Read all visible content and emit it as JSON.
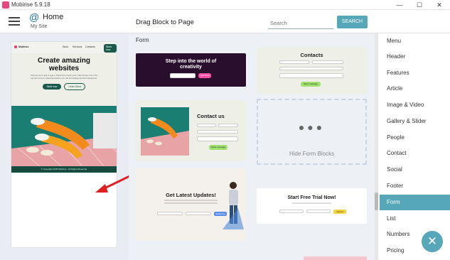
{
  "window": {
    "title": "Mobirise 5.9.18",
    "minimize": "—",
    "maximize": "☐",
    "close": "✕"
  },
  "header": {
    "home_title": "Home",
    "site_name": "My Site",
    "drag_title": "Drag Block to Page",
    "search_placeholder": "Search",
    "search_button": "SEARCH"
  },
  "preview": {
    "brand": "Mobirise",
    "nav_items": [
      "Work",
      "Services",
      "Contacts"
    ],
    "nav_button": "Work now",
    "hero_title": "Create amazing websites",
    "hero_text": "Click any text to edit or style it. Select text to insert a link. Click the blue icon in the top right corner to hide/show buttons, text, title and change the block background.",
    "btn_primary": "Start now",
    "btn_secondary": "Learn More",
    "footer_text": "© Copyright 2025 Mobirise - All Rights Reserved"
  },
  "center": {
    "section_label": "Form",
    "cards": {
      "creativity_title": "Step into the world of creativity",
      "creativity_btn": "Join Now",
      "contacts_title": "Contacts",
      "contacts_btn": "Send message",
      "contact_us_title": "Contact us",
      "contact_us_btn": "Send message",
      "hide_form_blocks": "Hide Form Blocks",
      "updates_title": "Get Latest Updates!",
      "updates_btn": "Subscribe",
      "trial_title": "Start Free Trial Now!",
      "trial_btn": "Submit"
    }
  },
  "categories": [
    "Menu",
    "Header",
    "Features",
    "Article",
    "Image & Video",
    "Gallery & Slider",
    "People",
    "Contact",
    "Social",
    "Footer",
    "Form",
    "List",
    "Numbers",
    "Pricing"
  ],
  "active_category": "Form",
  "fab_label": "✕",
  "colors": {
    "accent": "#56a8b8",
    "arrow": "#e02020"
  }
}
